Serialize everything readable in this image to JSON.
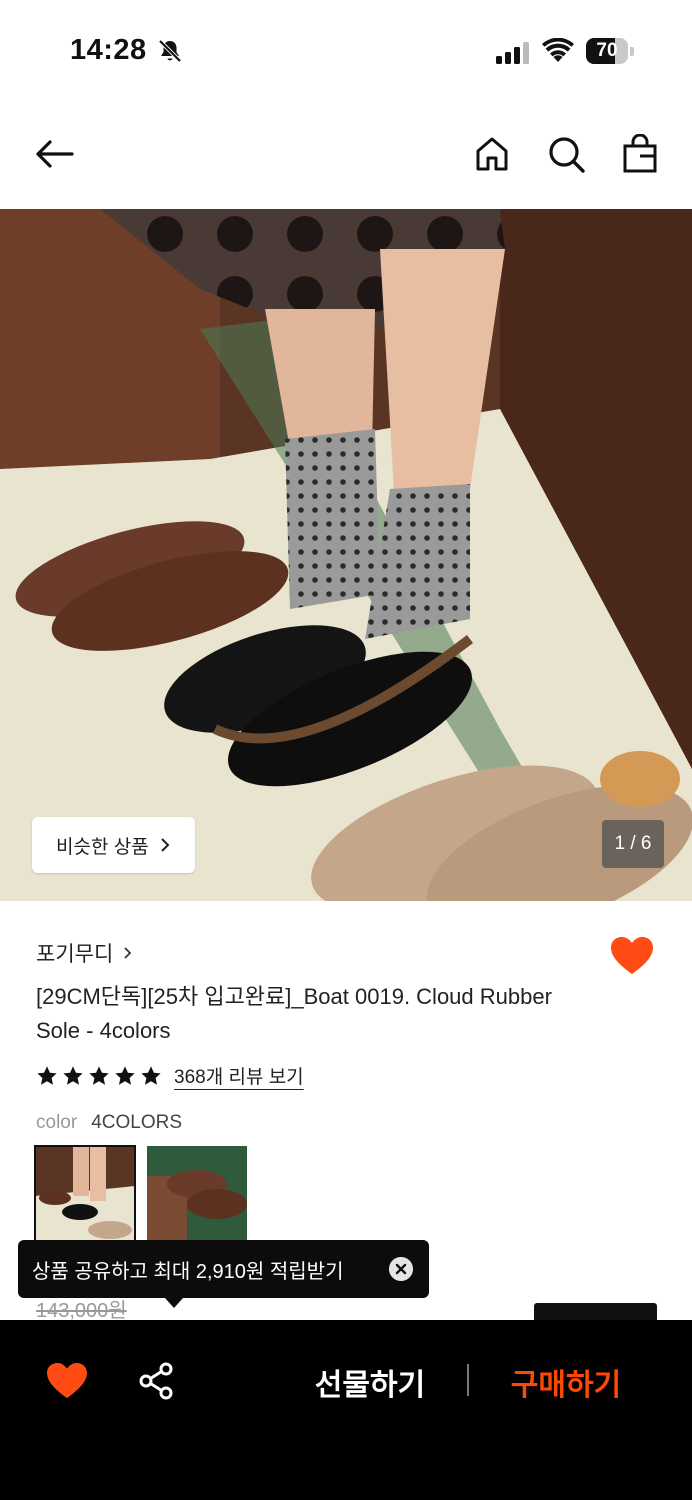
{
  "status_bar": {
    "time": "14:28",
    "battery": "70",
    "battery_level": 0.7
  },
  "nav": {
    "back": "back-arrow-icon",
    "home": "home-icon",
    "search": "search-icon",
    "bag": "shopping-bag-icon"
  },
  "hero": {
    "similar_label": "비슷한 상품",
    "image_counter": "1 / 6"
  },
  "product": {
    "brand": "포기무디",
    "title": "[29CM단독][25차 입고완료]_Boat 0019. Cloud Rubber Sole - 4colors",
    "rating_stars": 5,
    "review_link": "368개 리뷰 보기",
    "color_label": "color",
    "color_value": "4COLORS",
    "old_price": "143,000원"
  },
  "tooltip": {
    "text": "상품 공유하고 최대 2,910원 적립받기"
  },
  "bottom_bar": {
    "gift_label": "선물하기",
    "buy_label": "구매하기"
  },
  "colors": {
    "accent": "#ff4800",
    "heart": "#ff4b14",
    "black": "#000000"
  }
}
